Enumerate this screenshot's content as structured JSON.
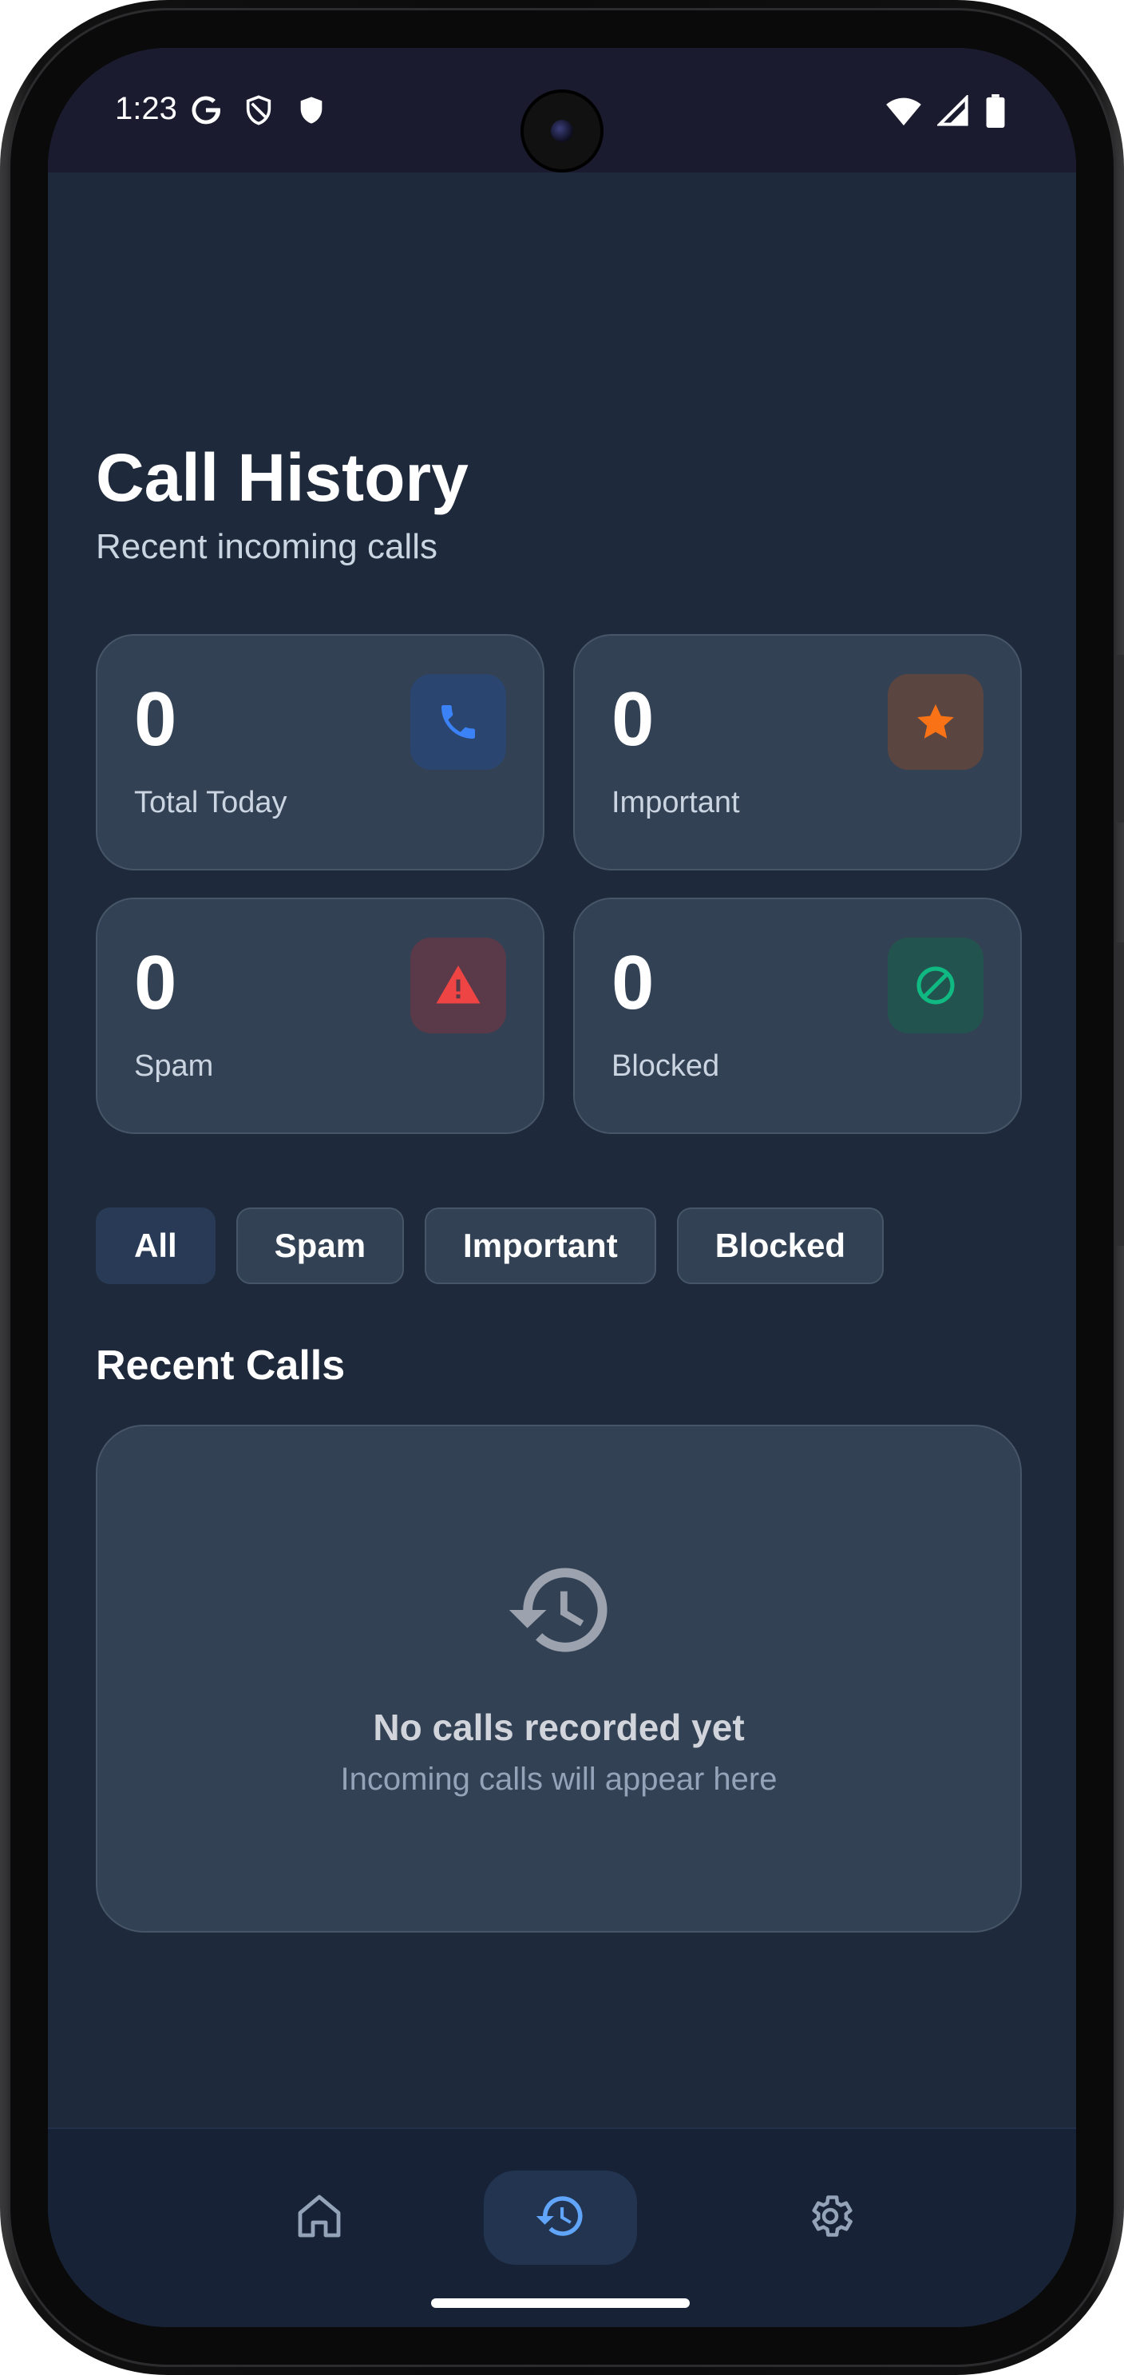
{
  "status_bar": {
    "time": "1:23",
    "left_icons": [
      "google-icon",
      "shield-outline-icon",
      "shield-icon"
    ],
    "right_icons": [
      "wifi-icon",
      "signal-icon",
      "battery-icon"
    ]
  },
  "header": {
    "title": "Call History",
    "subtitle": "Recent incoming calls"
  },
  "stats": [
    {
      "value": "0",
      "label": "Total Today",
      "icon": "phone-icon",
      "icon_color": "#3b82f6",
      "icon_bg": "#2a4670"
    },
    {
      "value": "0",
      "label": "Important",
      "icon": "star-icon",
      "icon_color": "#f97316",
      "icon_bg": "#5b4540"
    },
    {
      "value": "0",
      "label": "Spam",
      "icon": "warning-icon",
      "icon_color": "#ef4444",
      "icon_bg": "#5a3a48"
    },
    {
      "value": "0",
      "label": "Blocked",
      "icon": "block-icon",
      "icon_color": "#10b981",
      "icon_bg": "#23534f"
    }
  ],
  "filters": [
    {
      "label": "All",
      "active": true
    },
    {
      "label": "Spam",
      "active": false
    },
    {
      "label": "Important",
      "active": false
    },
    {
      "label": "Blocked",
      "active": false
    }
  ],
  "recent": {
    "title": "Recent Calls",
    "empty_title": "No calls recorded yet",
    "empty_subtitle": "Incoming calls will appear here"
  },
  "nav": [
    {
      "name": "home",
      "icon": "home-icon",
      "active": false
    },
    {
      "name": "history",
      "icon": "history-icon",
      "active": true
    },
    {
      "name": "settings",
      "icon": "gear-icon",
      "active": false
    }
  ],
  "colors": {
    "background": "#1e293b",
    "card": "#334155",
    "accent": "#3b82f6"
  }
}
